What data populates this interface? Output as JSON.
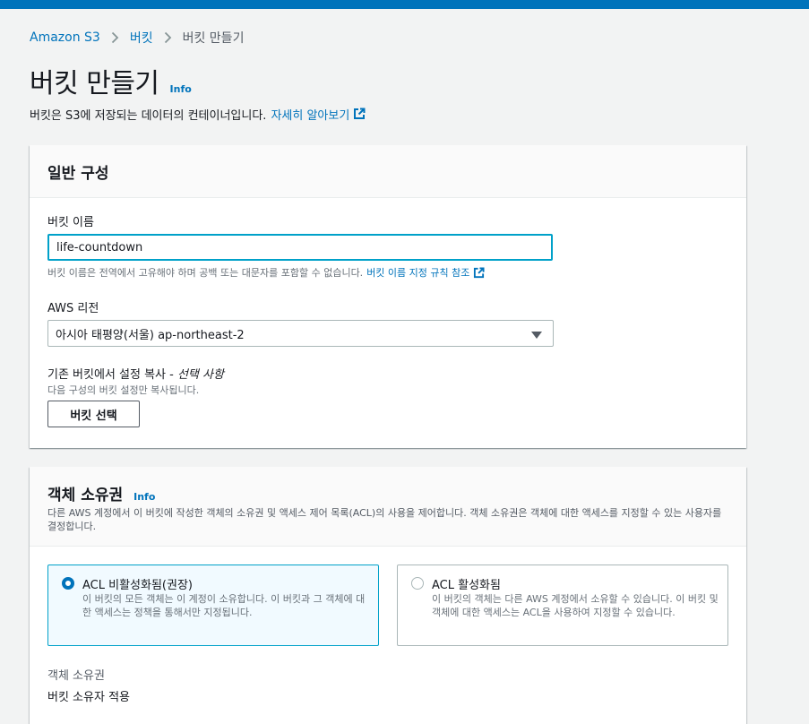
{
  "breadcrumb": {
    "items": [
      "Amazon S3",
      "버킷",
      "버킷 만들기"
    ]
  },
  "page": {
    "title": "버킷 만들기",
    "info": "Info",
    "description": "버킷은 S3에 저장되는 데이터의 컨테이너입니다.",
    "learn_more": "자세히 알아보기"
  },
  "general": {
    "title": "일반 구성",
    "bucket_name_label": "버킷 이름",
    "bucket_name_value": "life-countdown",
    "bucket_name_hint": "버킷 이름은 전역에서 고유해야 하며 공백 또는 대문자를 포함할 수 없습니다.",
    "bucket_name_rules_link": "버킷 이름 지정 규칙 참조",
    "region_label": "AWS 리전",
    "region_value": "아시아 태평양(서울) ap-northeast-2",
    "copy_label": "기존 버킷에서 설정 복사 - ",
    "copy_label_optional": "선택 사항",
    "copy_hint": "다음 구성의 버킷 설정만 복사됩니다.",
    "choose_bucket_button": "버킷 선택"
  },
  "ownership": {
    "title": "객체 소유권",
    "info": "Info",
    "description": "다른 AWS 계정에서 이 버킷에 작성한 객체의 소유권 및 액세스 제어 목록(ACL)의 사용을 제어합니다. 객체 소유권은 객체에 대한 액세스를 지정할 수 있는 사용자를 결정합니다.",
    "options": [
      {
        "title": "ACL 비활성화됨(권장)",
        "description": "이 버킷의 모든 객체는 이 계정이 소유합니다. 이 버킷과 그 객체에 대한 액세스는 정책을 통해서만 지정됩니다.",
        "selected": true
      },
      {
        "title": "ACL 활성화됨",
        "description": "이 버킷의 객체는 다른 AWS 계정에서 소유할 수 있습니다. 이 버킷 및 객체에 대한 액세스는 ACL을 사용하여 지정할 수 있습니다.",
        "selected": false
      }
    ],
    "ownership_label": "객체 소유권",
    "ownership_value": "버킷 소유자 적용"
  },
  "colors": {
    "accent": "#0073bb",
    "focus": "#00a1c9",
    "text": "#16191f"
  }
}
